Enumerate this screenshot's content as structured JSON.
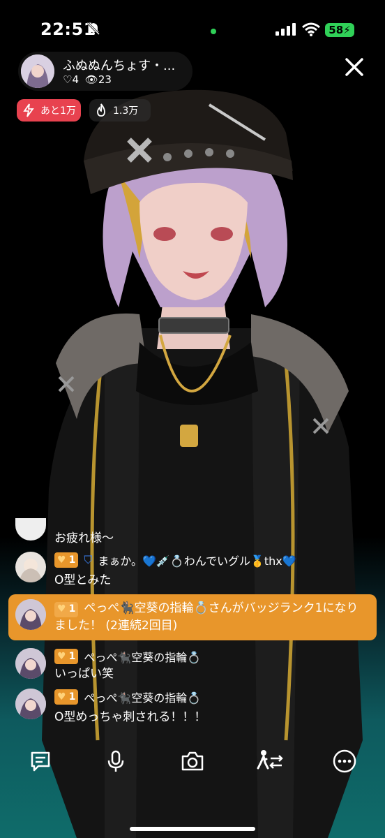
{
  "status_bar": {
    "time": "22:51",
    "battery": "58"
  },
  "streamer": {
    "name": "ふぬぬんちょす・...",
    "likes": "♡4",
    "viewers": "23"
  },
  "pills": {
    "goal": "あと1万",
    "points": "1.3万"
  },
  "comments": [
    {
      "badge": "",
      "name": "",
      "text": "お疲れ様～"
    },
    {
      "badge": "1",
      "name": "まぁか。💙💉💍わんでいグル🥇thx💙",
      "text": "O型とみた"
    },
    {
      "badge": "1",
      "name": "ぺっぺ🐈‍⬛空葵の指輪💍",
      "text": "いっぱい笑"
    },
    {
      "badge": "1",
      "name": "ぺっぺ🐈‍⬛空葵の指輪💍",
      "text": "O型めっちゃ刺される！！！"
    }
  ],
  "system_message": {
    "badge": "1",
    "text": "ぺっぺ🐈‍⬛空葵の指輪💍さんがバッジランク1になりました！ (2連続2回目)"
  },
  "colors": {
    "accent_red": "#e8424f",
    "badge_orange": "#e8962b",
    "status_green": "#30d158"
  },
  "icons": [
    "bell-slash-icon",
    "close-icon",
    "lightning-icon",
    "flame-icon",
    "comment-icon",
    "microphone-icon",
    "camera-icon",
    "collab-icon",
    "more-icon"
  ]
}
